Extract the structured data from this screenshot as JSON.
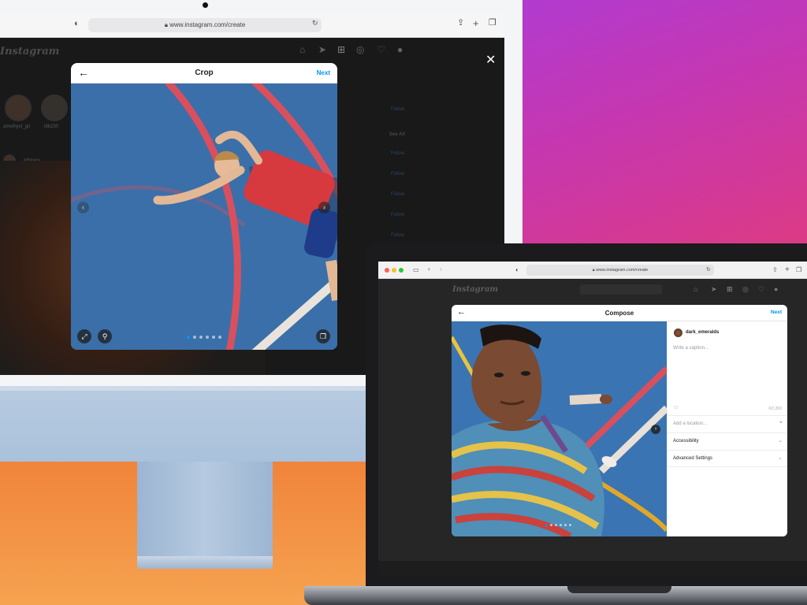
{
  "imac": {
    "browser": {
      "url": "www.instagram.com/create"
    },
    "instagram": {
      "logo": "Instagram",
      "stories": [
        {
          "name": "amethyst_gri"
        },
        {
          "name": "ldb230"
        }
      ],
      "feed_user": "elbears",
      "side_links": {
        "follow": "Follow",
        "see_all": "See All"
      }
    },
    "crop_modal": {
      "title": "Crop",
      "next_label": "Next",
      "dots": 6,
      "active_dot": 0
    }
  },
  "macbook": {
    "browser": {
      "url": "www.instagram.com/create"
    },
    "instagram": {
      "logo": "Instagram"
    },
    "compose_modal": {
      "title": "Compose",
      "next_label": "Next",
      "username": "dark_emeralds",
      "caption_placeholder": "Write a caption...",
      "char_count": "0/2,200",
      "location_placeholder": "Add a location...",
      "accessibility_label": "Accessibility",
      "advanced_label": "Advanced Settings",
      "dots": 6,
      "active_dot": 0
    }
  },
  "colors": {
    "accent_blue": "#0095f6",
    "court_blue": "#3a6ea8",
    "court_line_red": "#d94a5a"
  }
}
